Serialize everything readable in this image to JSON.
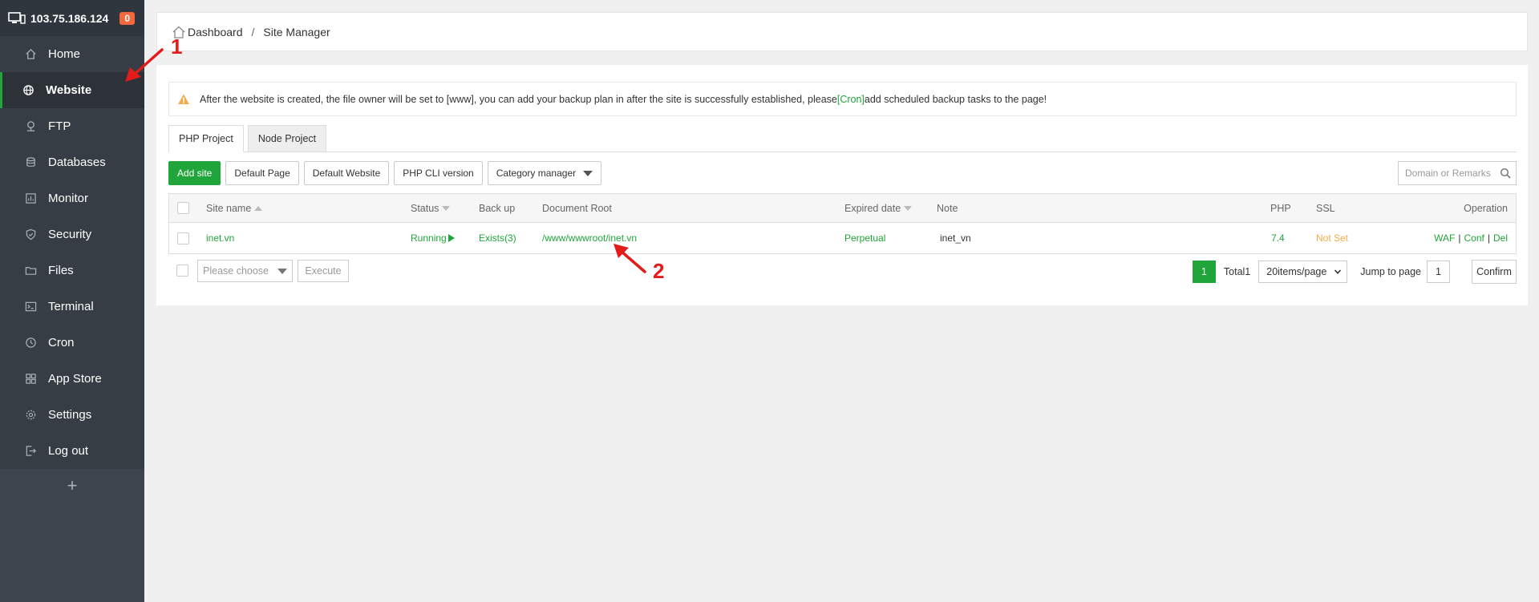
{
  "sidebar": {
    "ip": "103.75.186.124",
    "badge": "0",
    "items": [
      {
        "label": "Home",
        "icon": "home-icon"
      },
      {
        "label": "Website",
        "icon": "globe-icon",
        "active": true
      },
      {
        "label": "FTP",
        "icon": "ftp-icon"
      },
      {
        "label": "Databases",
        "icon": "database-icon"
      },
      {
        "label": "Monitor",
        "icon": "monitor-icon"
      },
      {
        "label": "Security",
        "icon": "shield-icon"
      },
      {
        "label": "Files",
        "icon": "folder-icon"
      },
      {
        "label": "Terminal",
        "icon": "terminal-icon"
      },
      {
        "label": "Cron",
        "icon": "clock-icon"
      },
      {
        "label": "App Store",
        "icon": "apps-icon"
      },
      {
        "label": "Settings",
        "icon": "gear-icon"
      },
      {
        "label": "Log out",
        "icon": "logout-icon"
      }
    ],
    "add_label": "+"
  },
  "breadcrumb": {
    "home": "Dashboard",
    "separator": "/",
    "current": "Site Manager"
  },
  "alert": {
    "text_before": "After the website is created, the file owner will be set to [www], you can add your backup plan in after the site is successfully established, please",
    "link": "[Cron]",
    "text_after": "add scheduled backup tasks to the page!"
  },
  "tabs": [
    "PHP Project",
    "Node Project"
  ],
  "toolbar": {
    "add_site": "Add site",
    "default_page": "Default Page",
    "default_website": "Default Website",
    "php_cli": "PHP CLI version",
    "category_manager": "Category manager",
    "search_placeholder": "Domain or Remarks"
  },
  "table": {
    "headers": {
      "site_name": "Site name",
      "status": "Status",
      "backup": "Back up",
      "doc_root": "Document Root",
      "expired": "Expired date",
      "note": "Note",
      "php": "PHP",
      "ssl": "SSL",
      "operation": "Operation"
    },
    "rows": [
      {
        "site_name": "inet.vn",
        "status": "Running",
        "backup": "Exists(3)",
        "doc_root": "/www/wwwroot/inet.vn",
        "expired": "Perpetual",
        "note": "inet_vn",
        "php": "7.4",
        "ssl": "Not Set",
        "ops": [
          "WAF",
          "Conf",
          "Del"
        ]
      }
    ]
  },
  "footer": {
    "select_placeholder": "Please choose",
    "execute": "Execute",
    "current_page": "1",
    "total": "Total1",
    "page_size": "20items/page",
    "jump_label": "Jump to page",
    "jump_value": "1",
    "confirm": "Confirm"
  },
  "annotations": {
    "one": "1",
    "two": "2"
  },
  "colors": {
    "accent": "#20a53a",
    "sidebar": "#3c444d",
    "badge": "#f4683b",
    "annotation": "#e31b1b",
    "warning": "#f0ad4e"
  }
}
